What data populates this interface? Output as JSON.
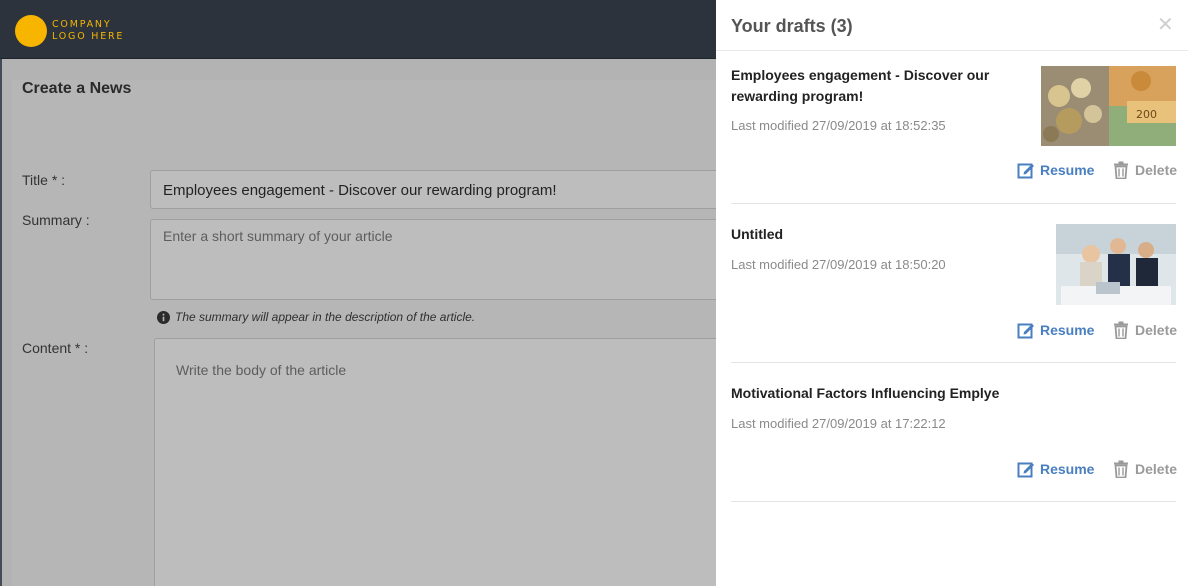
{
  "header": {
    "logo_line1": "COMPANY",
    "logo_line2": "LOGO HERE",
    "logo_color": "#f7b500"
  },
  "form": {
    "page_title": "Create a News",
    "title_label": "Title * :",
    "title_value": "Employees engagement - Discover our rewarding program!",
    "summary_label": "Summary :",
    "summary_placeholder": "Enter a short summary of your article",
    "summary_hint": "The summary will appear in the description of the article.",
    "content_label": "Content * :",
    "content_placeholder": "Write the body of the article"
  },
  "drafts_panel": {
    "title": "Your drafts (3)",
    "close_icon": "close-icon",
    "resume_label": "Resume",
    "delete_label": "Delete",
    "resume_color": "#4a7fbf",
    "drafts": [
      {
        "title": "Employees engagement - Discover our rewarding program!",
        "modified": "Last modified 27/09/2019 at 18:52:35",
        "thumbnail": "coins-and-banknotes-photo"
      },
      {
        "title": "Untitled",
        "modified": "Last modified 27/09/2019 at 18:50:20",
        "thumbnail": "business-meeting-photo"
      },
      {
        "title": "Motivational Factors Influencing Emplye",
        "modified": "Last modified 27/09/2019 at 17:22:12",
        "thumbnail": null
      }
    ]
  }
}
